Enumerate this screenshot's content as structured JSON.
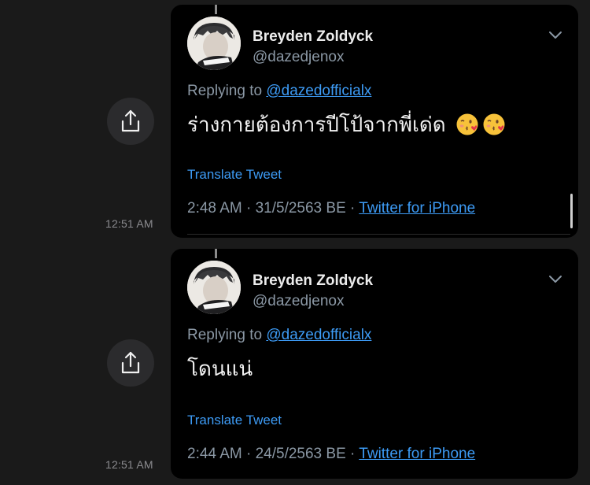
{
  "tweets": [
    {
      "author_name": "Breyden Zoldyck",
      "handle": "@dazedjenox",
      "replying_prefix": "Replying to",
      "replying_to": "@dazedofficialx",
      "text": "ร่างกายต้องการปีโป้จากพี่เด่ด",
      "emojis": [
        "kissing-face-with-heart-emoji",
        "kissing-face-with-heart-emoji"
      ],
      "translate_label": "Translate Tweet",
      "time_date": "2:48 AM · 31/5/2563 BE · ",
      "source": "Twitter for iPhone",
      "side_timestamp": "12:51 AM"
    },
    {
      "author_name": "Breyden Zoldyck",
      "handle": "@dazedjenox",
      "replying_prefix": "Replying to",
      "replying_to": "@dazedofficialx",
      "text": "โดนแน่",
      "emojis": [],
      "translate_label": "Translate Tweet",
      "time_date": "2:44 AM · 24/5/2563 BE · ",
      "source": "Twitter for iPhone",
      "side_timestamp": "12:51 AM"
    }
  ],
  "colors": {
    "background": "#1a1a1a",
    "card": "#000000",
    "link": "#3d9bf5",
    "secondary_text": "#8b98a5"
  }
}
